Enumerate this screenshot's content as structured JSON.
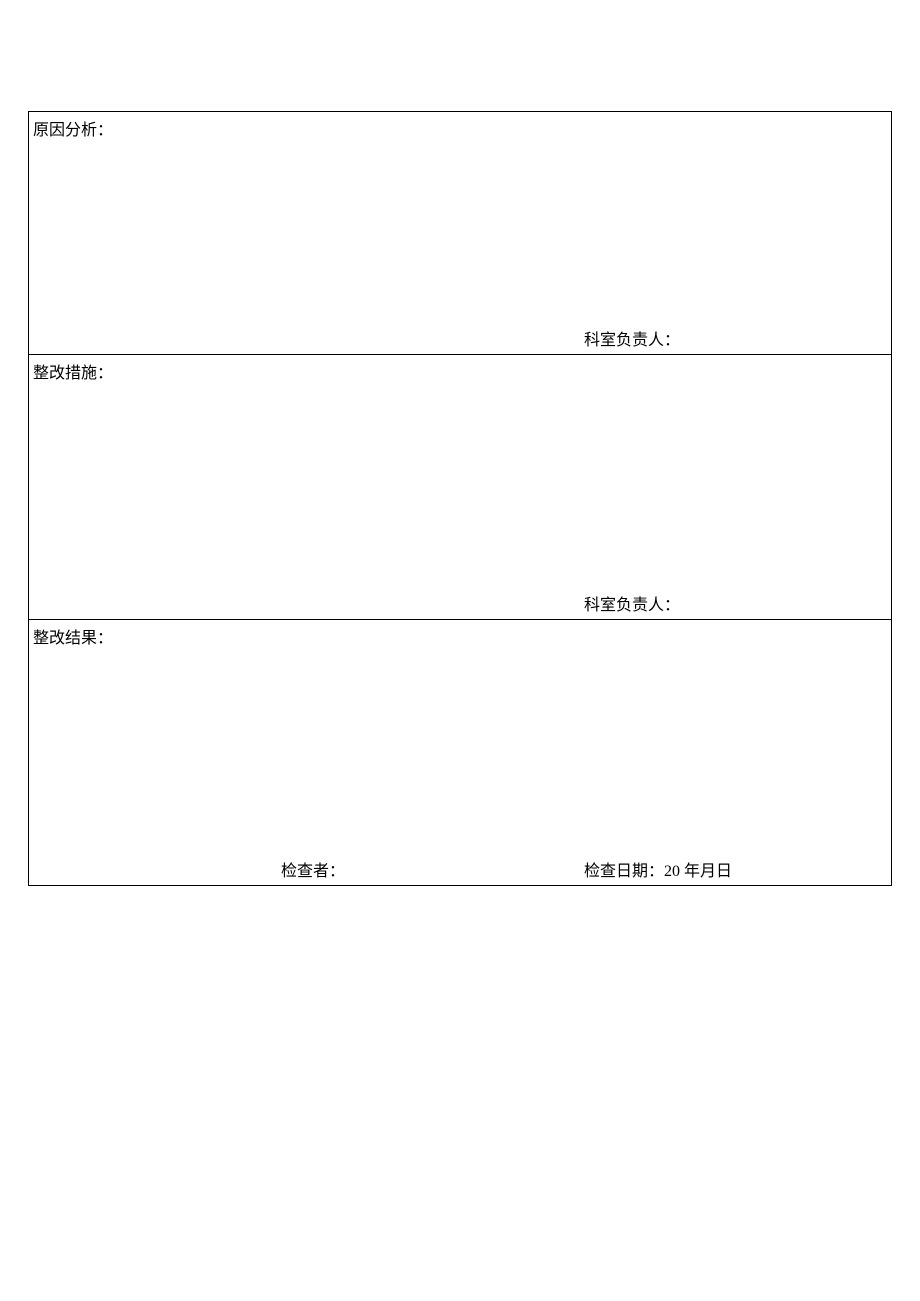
{
  "form": {
    "rows": [
      {
        "label": "原因分析：",
        "signature": "科室负责人："
      },
      {
        "label": "整改措施：",
        "signature": "科室负责人："
      },
      {
        "label": "整改结果：",
        "inspector": "检查者：",
        "date": "检查日期：20 年月日"
      }
    ]
  }
}
